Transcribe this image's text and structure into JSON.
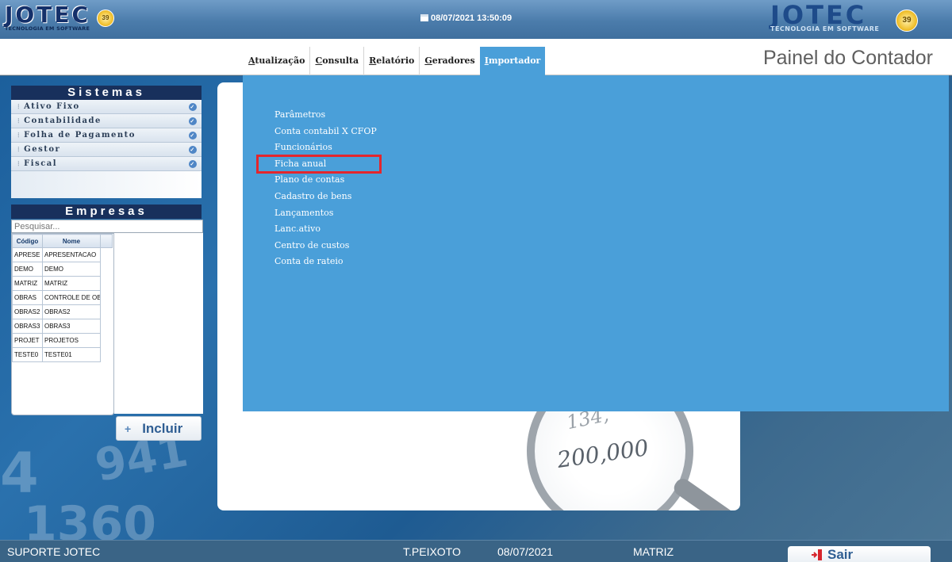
{
  "header": {
    "logo_text": "JOTEC",
    "logo_subtitle": "TECNOLOGIA EM SOFTWARE",
    "logo_badge": "39",
    "datetime": "08/07/2021  13:50:09"
  },
  "menu": {
    "items": [
      {
        "first": "A",
        "rest": "tualização"
      },
      {
        "first": "C",
        "rest": "onsulta"
      },
      {
        "first": "R",
        "rest": "elatório"
      },
      {
        "first": "G",
        "rest": "eradores"
      },
      {
        "first": "I",
        "rest": "mportador"
      }
    ],
    "active": "Importador"
  },
  "page_title": "Painel do Contador",
  "sistemas": {
    "title": "Sistemas",
    "items": [
      "Ativo Fixo",
      "Contabilidade",
      "Folha de Pagamento",
      "Gestor",
      "Fiscal"
    ]
  },
  "empresas": {
    "title": "Empresas",
    "search_placeholder": "Pesquisar...",
    "columns": [
      "Código",
      "Nome"
    ],
    "rows": [
      {
        "codigo": "APRESE",
        "nome": "APRESENTACAO"
      },
      {
        "codigo": "DEMO",
        "nome": "DEMO"
      },
      {
        "codigo": "MATRIZ",
        "nome": "MATRIZ"
      },
      {
        "codigo": "OBRAS",
        "nome": "CONTROLE DE OB"
      },
      {
        "codigo": "OBRAS2",
        "nome": "OBRAS2"
      },
      {
        "codigo": "OBRAS3",
        "nome": "OBRAS3"
      },
      {
        "codigo": "PROJET",
        "nome": "PROJETOS"
      },
      {
        "codigo": "TESTE0",
        "nome": "TESTE01"
      }
    ],
    "add_button": "Incluir"
  },
  "card": {
    "mag_text": "200,000",
    "mag_text2": "134,"
  },
  "importador_menu": {
    "items": [
      "Parâmetros",
      "Conta contabil X CFOP",
      "Funcionários",
      "Ficha anual",
      "Plano de contas",
      "Cadastro de bens",
      "Lançamentos",
      "Lanc.ativo",
      "Centro de custos",
      "Conta de rateio"
    ],
    "highlighted": "Ficha anual"
  },
  "footer": {
    "user": "SUPORTE JOTEC",
    "operator": "T.PEIXOTO",
    "date": "08/07/2021",
    "company": "MATRIZ",
    "exit_button": "Sair"
  },
  "colors": {
    "dropdown_bg": "#4a9fd9",
    "highlight_border": "#e3262d",
    "header_bg": "#4b7cab",
    "footer_bg": "#3a6486"
  }
}
